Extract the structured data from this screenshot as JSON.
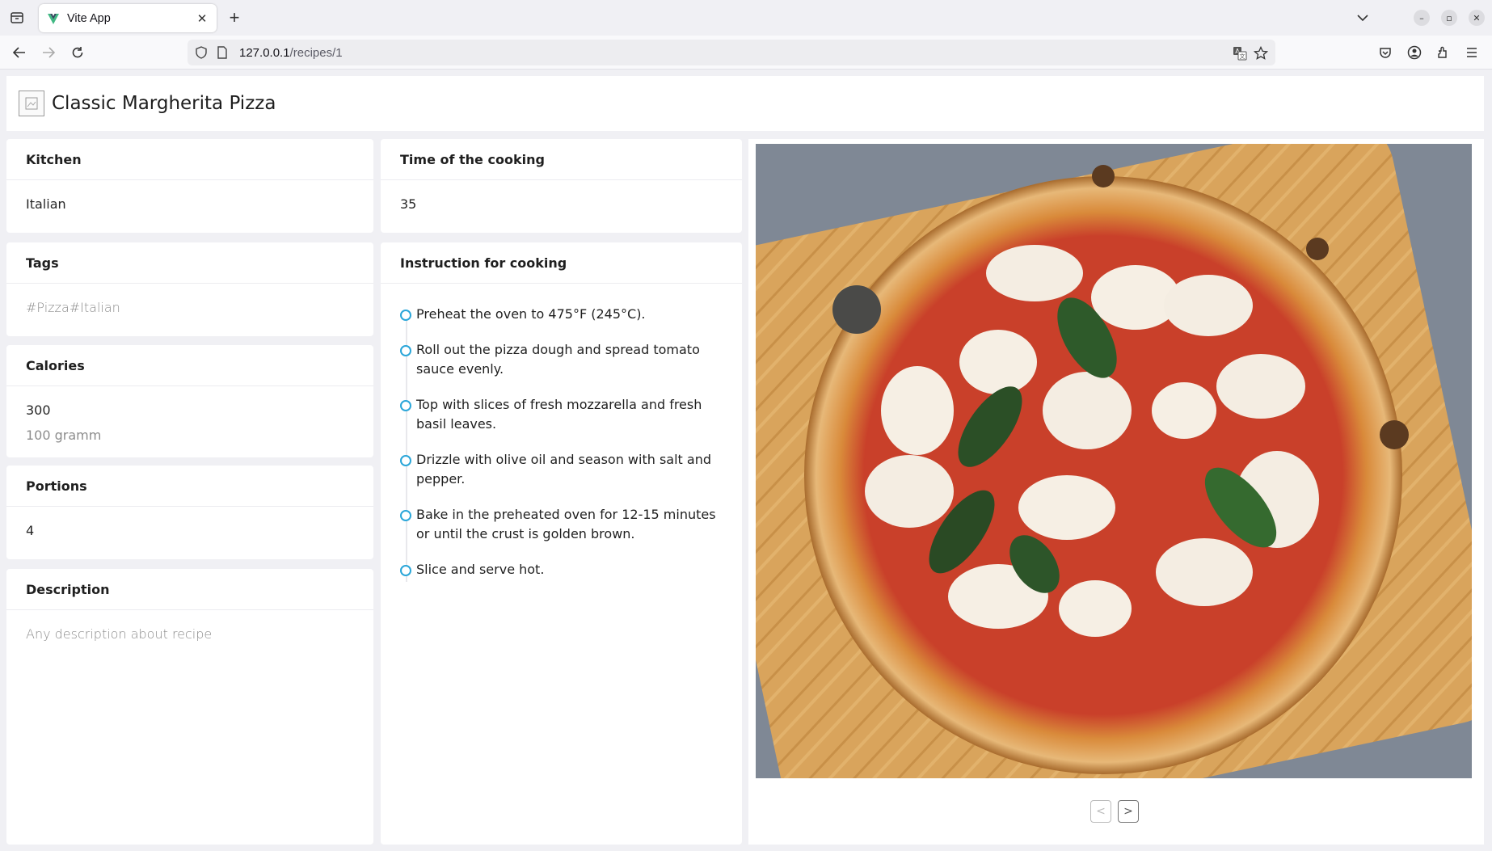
{
  "browser": {
    "tab_title": "Vite App",
    "url_host": "127.0.0.1",
    "url_path": "/recipes/1"
  },
  "recipe": {
    "title": "Classic Margherita Pizza",
    "kitchen": {
      "label": "Kitchen",
      "value": "Italian"
    },
    "time": {
      "label": "Time of the cooking",
      "value": "35"
    },
    "tags": {
      "label": "Tags",
      "value": "#Pizza#Italian"
    },
    "calories": {
      "label": "Calories",
      "value": "300",
      "unit": "100 gramm"
    },
    "portions": {
      "label": "Portions",
      "value": "4"
    },
    "description": {
      "label": "Description",
      "value": "Any description about recipe"
    },
    "instructions": {
      "label": "Instruction for cooking",
      "steps": [
        "Preheat the oven to 475°F (245°C).",
        "Roll out the pizza dough and spread tomato sauce evenly.",
        "Top with slices of fresh mozzarella and fresh basil leaves.",
        "Drizzle with olive oil and season with salt and pepper.",
        "Bake in the preheated oven for 12-15 minutes or until the crust is golden brown.",
        "Slice and serve hot."
      ]
    }
  },
  "gallery": {
    "prev_label": "<",
    "next_label": ">"
  },
  "colors": {
    "accent": "#2aa6d9",
    "page_bg": "#f0f0f4"
  }
}
